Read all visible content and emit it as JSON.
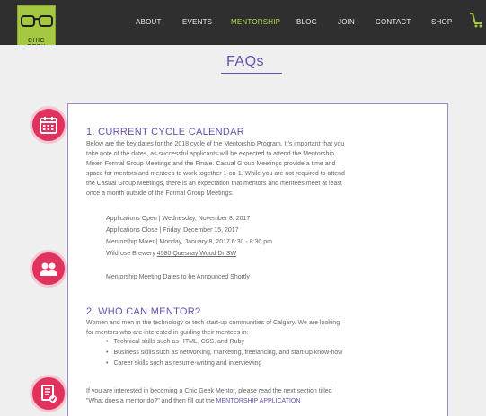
{
  "logo": {
    "text": "CHIC GEEK"
  },
  "nav": {
    "items": [
      {
        "label": "ABOUT",
        "active": false
      },
      {
        "label": "EVENTS",
        "active": false
      },
      {
        "label": "MENTORSHIP",
        "active": true
      },
      {
        "label": "BLOG",
        "active": false
      },
      {
        "label": "JOIN",
        "active": false
      },
      {
        "label": "CONTACT",
        "active": false
      },
      {
        "label": "SHOP",
        "active": false
      }
    ],
    "cart_icon": "cart-icon"
  },
  "page": {
    "title": "FAQs"
  },
  "section1": {
    "icon": "calendar-icon",
    "heading": "1. CURRENT CYCLE CALENDAR",
    "lines": [
      "Below are the key dates for the 2018 cycle of the Mentorship Program. It's important that you",
      "take note of the dates, as successful applicants will be expected to attend the Mentorship",
      "Mixer, Formal Group Meetings and the Finale. Casual Group Meetings provide a time and",
      "space for mentors and mentees to work together 1-on-1. While you are not required to attend",
      "the Casual Group Meetings, there is an expectation that mentors and mentees meet at least",
      "once a month outside of the Formal Group Meetings."
    ],
    "dates": [
      "Applications Open | Wednesday, November 8, 2017",
      "Applications Close | Friday, December 15, 2017",
      "Mentorship Mixer | Monday, January 8, 2017 6:30 - 8:30 pm"
    ],
    "venue_prefix": "Wildrose Brewery ",
    "venue_link": "4580 Quesnay Wood Dr SW",
    "note": "Mentorship Meeting Dates to be Announced Shortly"
  },
  "section2": {
    "icon": "people-icon",
    "heading": "2. WHO CAN MENTOR?",
    "lines": [
      "Women and men in the technology or tech start-up communities of Calgary. We are looking",
      "for mentors who are interested in guiding their mentees in:"
    ],
    "bullets": [
      "Technical skills such as HTML, CSS, and Ruby",
      "Business skills such as networking, marketing, freelancing, and start-up know-how",
      "Career skills such as resume-writing and interviewing"
    ],
    "footer_line1": "If you are interested in becoming a Chic Geek Mentor, please read the next section titled",
    "footer_line2_prefix": "\"What does a mentor do?\" and then fill out the ",
    "footer_link": "MENTORSHIP APPLICATION"
  },
  "section3": {
    "icon": "document-check-icon"
  }
}
